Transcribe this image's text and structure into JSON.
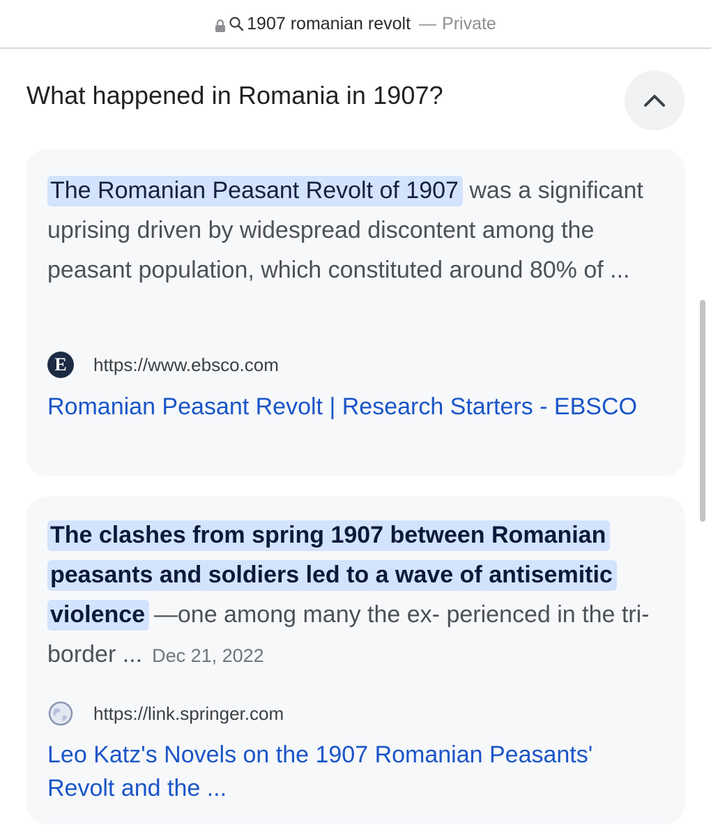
{
  "urlbar": {
    "icons": [
      "lock-icon",
      "search-icon"
    ],
    "query": "1907 romanian revolt",
    "separator": "—",
    "mode": "Private"
  },
  "header": {
    "question": "What happened in Romania in 1907?",
    "toggle_icon": "chevron-up-icon"
  },
  "results": [
    {
      "highlight": "The Romanian Peasant Revolt of 1907",
      "snippet": " was a significant uprising driven by widespread discontent among the peasant population, which constituted around 80% of ...",
      "date": "",
      "favicon": "ebsco-logo-icon",
      "favicon_letter": "E",
      "url": "https://www.ebsco.com",
      "title": "Romanian Peasant Revolt | Research Starters - EBSCO"
    },
    {
      "highlight": "The clashes from spring 1907 between Romanian peasants and soldiers led to a wave of antisemitic violence",
      "snippet": " —one among many the ex- perienced in the tri-border ...",
      "date": "Dec 21, 2022",
      "favicon": "globe-icon",
      "url": "https://link.springer.com",
      "title": "Leo Katz's Novels on the 1907 Romanian Peasants' Revolt and the ..."
    }
  ],
  "colors": {
    "highlight_bg": "#d3e3fd",
    "link": "#1a55c8",
    "card_bg": "#f7f8fa",
    "snippet_text": "#4d5156"
  }
}
